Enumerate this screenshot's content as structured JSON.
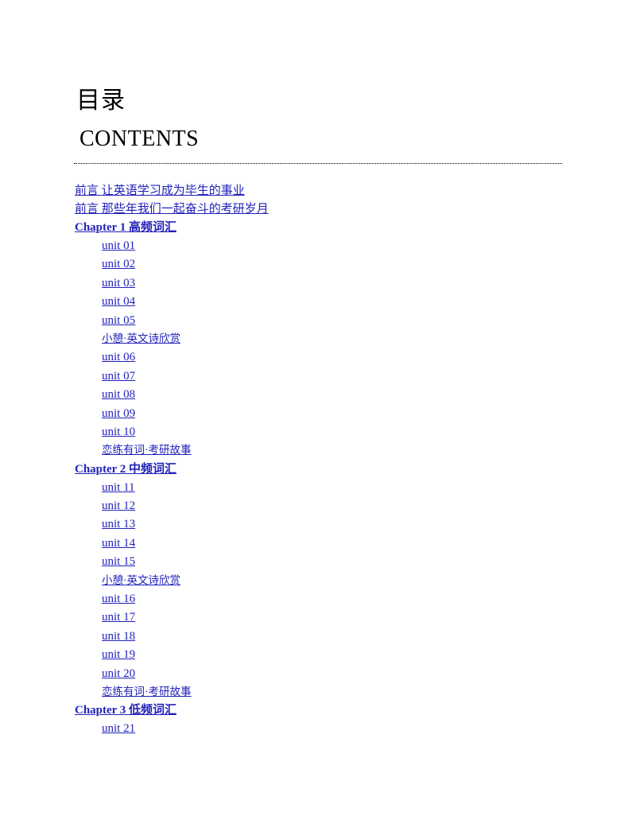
{
  "document": {
    "title_cn": "目录",
    "title_en": "CONTENTS",
    "link_color": "#2222bb",
    "text_color": "#000000",
    "background_color": "#ffffff"
  },
  "toc": {
    "entries": [
      {
        "label": "前言 让英语学习成为毕生的事业",
        "level": "front"
      },
      {
        "label": "前言 那些年我们一起奋斗的考研岁月",
        "level": "front"
      },
      {
        "label": "Chapter 1 高频词汇",
        "level": "chapter"
      },
      {
        "label": "unit 01",
        "level": "unit"
      },
      {
        "label": "unit 02",
        "level": "unit"
      },
      {
        "label": "unit 03",
        "level": "unit"
      },
      {
        "label": "unit 04",
        "level": "unit"
      },
      {
        "label": "unit 05",
        "level": "unit"
      },
      {
        "label": "小憩·英文诗欣赏",
        "level": "special"
      },
      {
        "label": "unit 06",
        "level": "unit"
      },
      {
        "label": "unit 07",
        "level": "unit"
      },
      {
        "label": "unit 08",
        "level": "unit"
      },
      {
        "label": "unit 09",
        "level": "unit"
      },
      {
        "label": "unit 10",
        "level": "unit"
      },
      {
        "label": "恋练有词·考研故事",
        "level": "special"
      },
      {
        "label": "Chapter 2 中频词汇",
        "level": "chapter"
      },
      {
        "label": "unit 11",
        "level": "unit"
      },
      {
        "label": "unit 12",
        "level": "unit"
      },
      {
        "label": "unit 13",
        "level": "unit"
      },
      {
        "label": "unit 14",
        "level": "unit"
      },
      {
        "label": "unit 15",
        "level": "unit"
      },
      {
        "label": "小憩·英文诗欣赏",
        "level": "special"
      },
      {
        "label": "unit 16",
        "level": "unit"
      },
      {
        "label": "unit 17",
        "level": "unit"
      },
      {
        "label": "unit 18",
        "level": "unit"
      },
      {
        "label": "unit 19",
        "level": "unit"
      },
      {
        "label": "unit 20",
        "level": "unit"
      },
      {
        "label": "恋练有词·考研故事",
        "level": "special"
      },
      {
        "label": "Chapter 3 低频词汇",
        "level": "chapter"
      },
      {
        "label": "unit 21",
        "level": "unit"
      }
    ]
  }
}
